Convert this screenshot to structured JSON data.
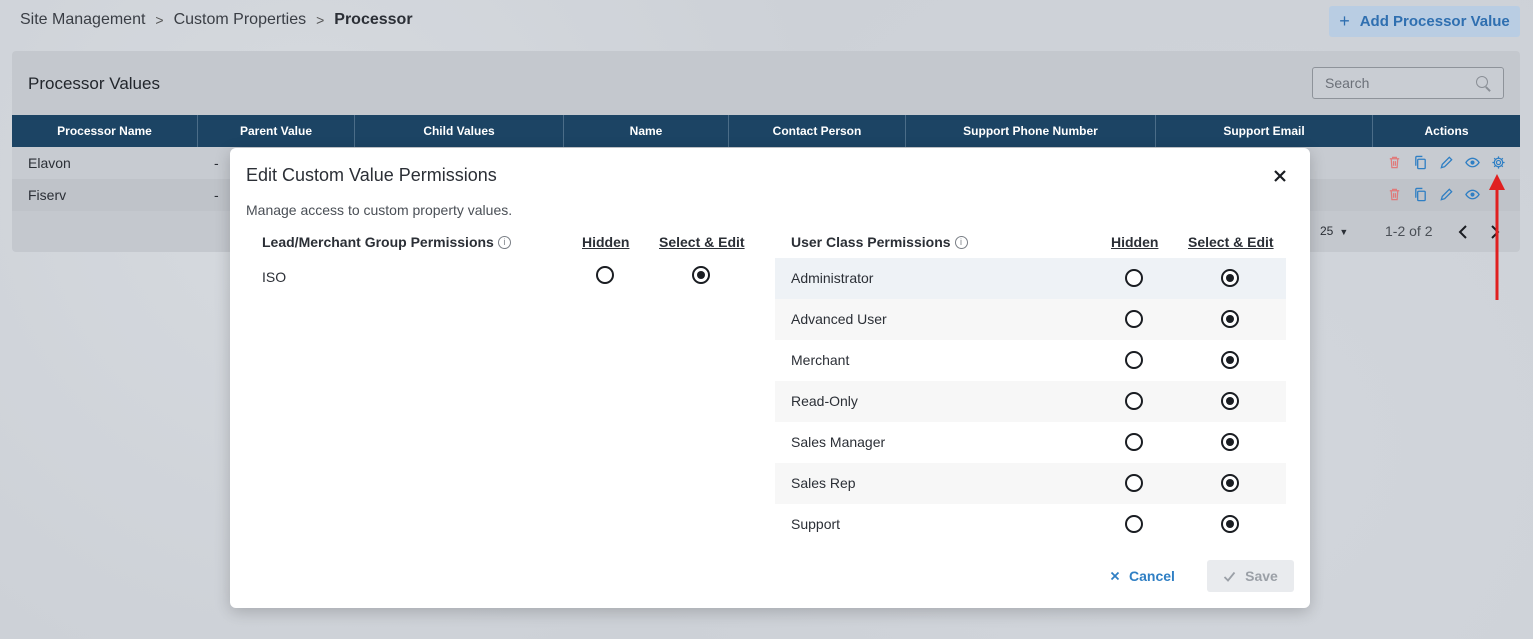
{
  "breadcrumb": {
    "item1": "Site Management",
    "item2": "Custom Properties",
    "current": "Processor",
    "separator": ">"
  },
  "header": {
    "add_button_label": "Add Processor Value",
    "add_icon": "+"
  },
  "card": {
    "title": "Processor Values",
    "search_placeholder": "Search"
  },
  "table": {
    "columns": [
      "Processor Name",
      "Parent Value",
      "Child Values",
      "Name",
      "Contact Person",
      "Support Phone Number",
      "Support Email",
      "Actions"
    ],
    "rows": [
      {
        "name": "Elavon",
        "parent": "-"
      },
      {
        "name": "Fiserv",
        "parent": "-"
      }
    ],
    "action_icons": [
      "trash-icon",
      "copy-icon",
      "pencil-icon",
      "eye-icon",
      "gear-icon"
    ]
  },
  "pager": {
    "page_size": "25",
    "range": "1-2 of 2"
  },
  "modal": {
    "title": "Edit Custom Value Permissions",
    "description": "Manage access to custom property values.",
    "lm_section": {
      "title": "Lead/Merchant Group Permissions",
      "col_hidden": "Hidden",
      "col_edit": "Select & Edit",
      "rows": [
        {
          "label": "ISO",
          "value": "Select & Edit"
        }
      ]
    },
    "uc_section": {
      "title": "User Class Permissions",
      "col_hidden": "Hidden",
      "col_edit": "Select & Edit",
      "rows": [
        {
          "label": "Administrator",
          "value": "Select & Edit"
        },
        {
          "label": "Advanced User",
          "value": "Select & Edit"
        },
        {
          "label": "Merchant",
          "value": "Select & Edit"
        },
        {
          "label": "Read-Only",
          "value": "Select & Edit"
        },
        {
          "label": "Sales Manager",
          "value": "Select & Edit"
        },
        {
          "label": "Sales Rep",
          "value": "Select & Edit"
        },
        {
          "label": "Support",
          "value": "Select & Edit"
        }
      ]
    },
    "cancel_label": "Cancel",
    "save_label": "Save"
  },
  "colors": {
    "table_header": "#1c4464",
    "accent_blue": "#2f7fc4",
    "delete_red": "#e07a7a",
    "arrow_red": "#e02020"
  }
}
